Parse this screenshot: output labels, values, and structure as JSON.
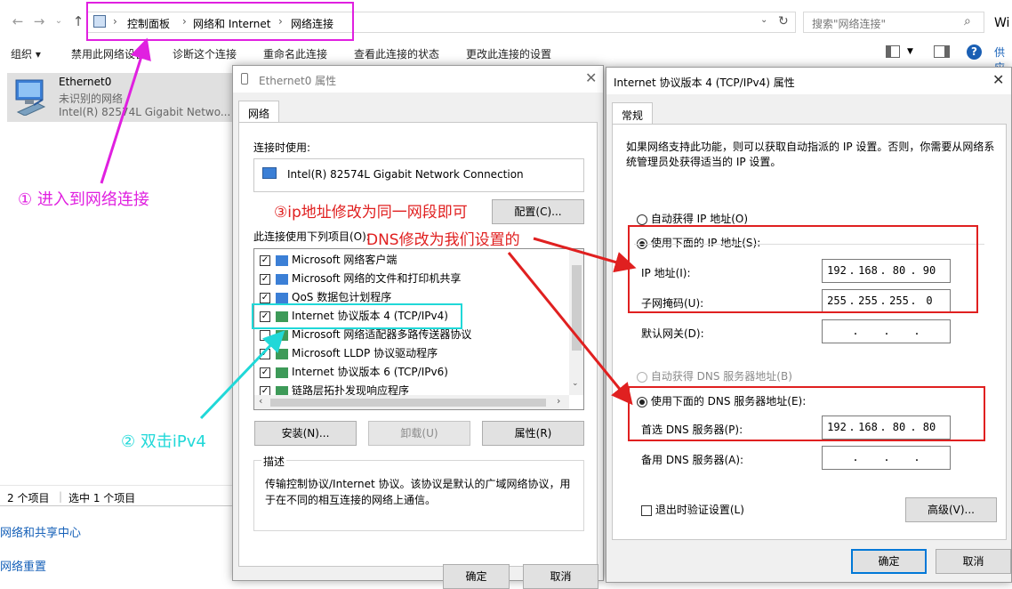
{
  "explorer": {
    "breadcrumb": [
      "控制面板",
      "网络和 Internet",
      "网络连接"
    ],
    "search_placeholder": "搜索\"网络连接\"",
    "edge_text": "Wi",
    "edge_text2": "供应",
    "toolbar": {
      "organize": "组织 ▾",
      "disable": "禁用此网络设备",
      "diagnose": "诊断这个连接",
      "rename": "重命名此连接",
      "view_status": "查看此连接的状态",
      "change_settings": "更改此连接的设置"
    },
    "connection": {
      "name": "Ethernet0",
      "status": "未识别的网络",
      "adapter": "Intel(R) 82574L Gigabit Netwo..."
    },
    "status_bar": {
      "count": "2 个项目",
      "selected": "选中 1 个项目"
    },
    "left_links": [
      "网络和共享中心",
      "网络重置"
    ]
  },
  "eth_dialog": {
    "title": "Ethernet0 属性",
    "tab": "网络",
    "connect_using_label": "连接时使用:",
    "adapter": "Intel(R) 82574L Gigabit Network Connection",
    "configure_button": "配置(C)...",
    "items_label": "此连接使用下列项目(O):",
    "items": [
      {
        "label": "Microsoft 网络客户端",
        "checked": true
      },
      {
        "label": "Microsoft 网络的文件和打印机共享",
        "checked": true
      },
      {
        "label": "QoS 数据包计划程序",
        "checked": true
      },
      {
        "label": "Internet 协议版本 4 (TCP/IPv4)",
        "checked": true
      },
      {
        "label": "Microsoft 网络适配器多路传送器协议",
        "checked": false
      },
      {
        "label": "Microsoft LLDP 协议驱动程序",
        "checked": true
      },
      {
        "label": "Internet 协议版本 6 (TCP/IPv6)",
        "checked": true
      },
      {
        "label": "链路层拓扑发现响应程序",
        "checked": true
      }
    ],
    "install_button": "安装(N)...",
    "uninstall_button": "卸载(U)",
    "properties_button": "属性(R)",
    "description_label": "描述",
    "description_text": "传输控制协议/Internet 协议。该协议是默认的广域网络协议，用于在不同的相互连接的网络上通信。",
    "ok_button": "确定",
    "cancel_button": "取消"
  },
  "ipv4_dialog": {
    "title": "Internet 协议版本 4 (TCP/IPv4) 属性",
    "tab": "常规",
    "intro": "如果网络支持此功能，则可以获取自动指派的 IP 设置。否则，你需要从网络系统管理员处获得适当的 IP 设置。",
    "auto_ip": "自动获得 IP 地址(O)",
    "manual_ip": "使用下面的 IP 地址(S):",
    "ip_label": "IP 地址(I):",
    "ip_value": [
      "192",
      "168",
      "80",
      "90"
    ],
    "subnet_label": "子网掩码(U):",
    "subnet_value": [
      "255",
      "255",
      "255",
      "0"
    ],
    "gateway_label": "默认网关(D):",
    "auto_dns": "自动获得 DNS 服务器地址(B)",
    "manual_dns": "使用下面的 DNS 服务器地址(E):",
    "preferred_dns_label": "首选 DNS 服务器(P):",
    "preferred_dns_value": [
      "192",
      "168",
      "80",
      "80"
    ],
    "alternate_dns_label": "备用 DNS 服务器(A):",
    "validate_label": "退出时验证设置(L)",
    "advanced_button": "高级(V)...",
    "ok_button": "确定",
    "cancel_button": "取消"
  },
  "annotations": {
    "step1": "① 进入到网络连接",
    "step2": "② 双击iPv4",
    "step3": "③ip地址修改为同一网段即可",
    "step3b": "DNS修改为我们设置的",
    "magenta": "#e020e0",
    "cyan": "#20d8d8",
    "red": "#e02020"
  }
}
